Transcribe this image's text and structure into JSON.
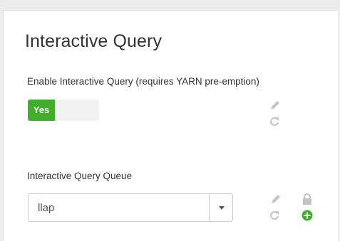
{
  "section": {
    "title": "Interactive Query"
  },
  "enable": {
    "label": "Enable Interactive Query (requires YARN pre-emption)",
    "toggle_label": "Yes",
    "enabled": true,
    "toggle_on_color": "#3fae2a"
  },
  "queue": {
    "label": "Interactive Query Queue",
    "value": "llap"
  },
  "icons": {
    "edit": "pencil-icon",
    "undo": "undo-icon",
    "lock": "lock-icon",
    "add": "plus-circle-icon",
    "dropdown": "caret-down-icon"
  },
  "colors": {
    "icon_gray": "#c4c4c4",
    "add_green": "#3fae2a"
  }
}
